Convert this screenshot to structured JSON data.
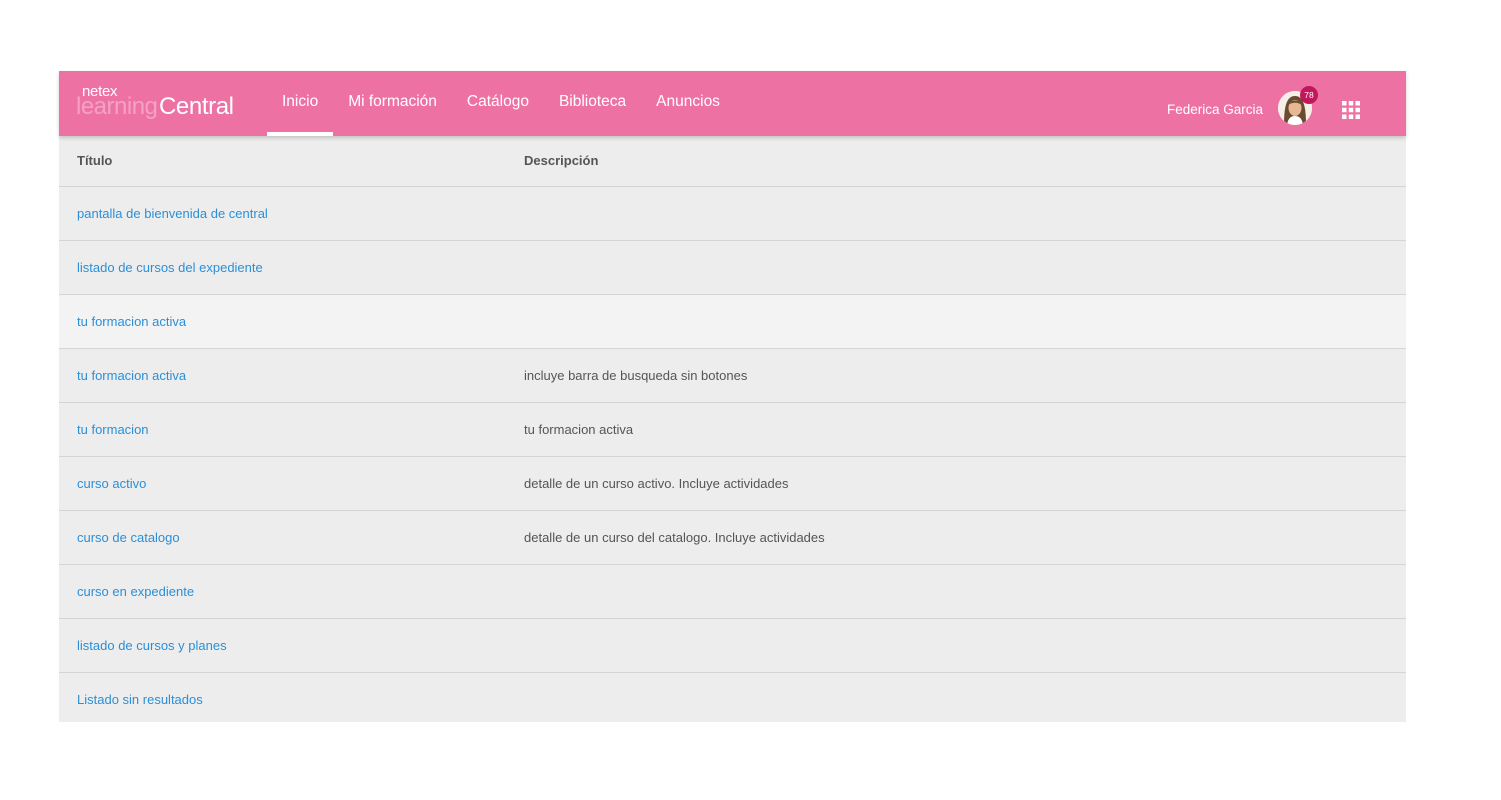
{
  "brand": {
    "netex": "netex",
    "learning": "learning",
    "central": "Central"
  },
  "nav": [
    {
      "label": "Inicio",
      "active": true
    },
    {
      "label": "Mi formación",
      "active": false
    },
    {
      "label": "Catálogo",
      "active": false
    },
    {
      "label": "Biblioteca",
      "active": false
    },
    {
      "label": "Anuncios",
      "active": false
    }
  ],
  "user": {
    "name": "Federica Garcia",
    "notifications": "78",
    "avatar_icon": "user-avatar",
    "apps_icon": "apps-grid-icon"
  },
  "colors": {
    "header": "#ee71a3",
    "link": "#2b8fd8",
    "badge": "#c2185b"
  },
  "table": {
    "headers": {
      "title": "Título",
      "description": "Descripción"
    },
    "rows": [
      {
        "title": "pantalla de bienvenida de central",
        "description": ""
      },
      {
        "title": "listado de cursos del expediente",
        "description": ""
      },
      {
        "title": "tu formacion activa",
        "description": ""
      },
      {
        "title": "tu formacion activa",
        "description": "incluye barra de busqueda sin botones"
      },
      {
        "title": "tu formacion",
        "description": "tu formacion activa"
      },
      {
        "title": "curso activo",
        "description": "detalle de un curso activo. Incluye actividades"
      },
      {
        "title": "curso de catalogo",
        "description": "detalle de un curso del catalogo. Incluye actividades"
      },
      {
        "title": "curso en expediente",
        "description": ""
      },
      {
        "title": "listado de cursos y planes",
        "description": ""
      },
      {
        "title": "Listado sin resultados",
        "description": ""
      }
    ]
  }
}
